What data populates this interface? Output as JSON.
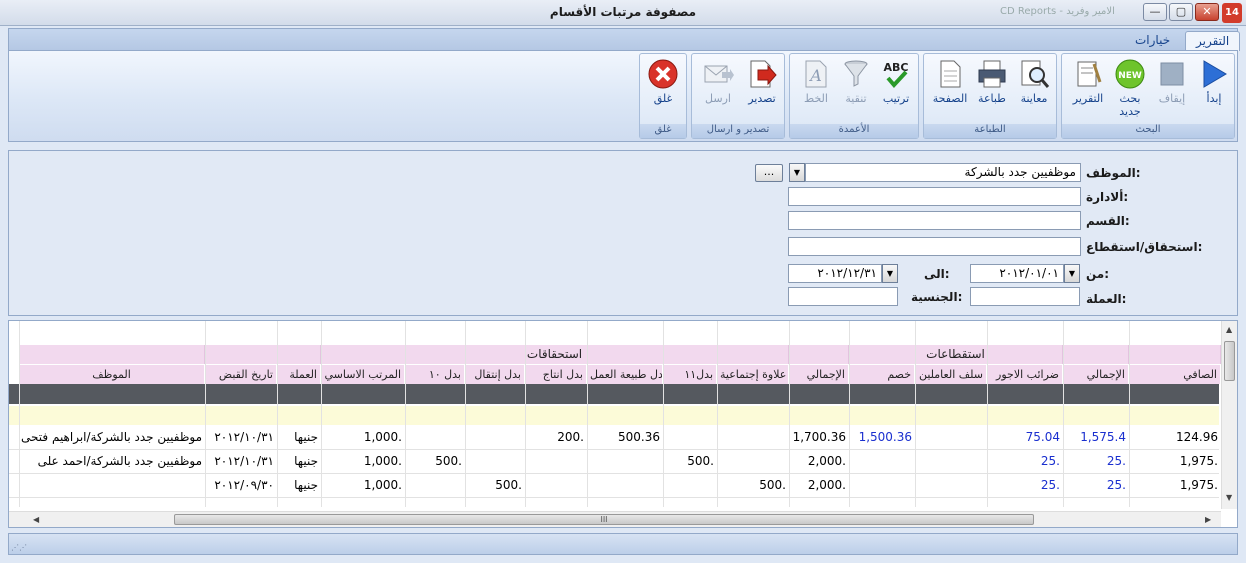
{
  "window": {
    "title": "مصفوفة مرتبات الأقسام",
    "background_title": "CD Reports  -  الامير وفريد",
    "app_icon": "14",
    "minimize": "—",
    "maximize": "▢",
    "close": "✕"
  },
  "ribbon": {
    "tabs": [
      {
        "label": "التقرير",
        "active": true
      },
      {
        "label": "خيارات",
        "active": false
      }
    ],
    "groups": {
      "search": {
        "label": "البحث",
        "buttons": [
          {
            "label": "إبدأ",
            "icon": "play-icon",
            "disabled": false
          },
          {
            "label": "إيقاف",
            "icon": "stop-icon",
            "disabled": true
          },
          {
            "label": "بحث جديد",
            "icon": "new-search-icon",
            "disabled": false
          },
          {
            "label": "التقرير",
            "icon": "report-icon",
            "disabled": false
          }
        ]
      },
      "print": {
        "label": "الطباعة",
        "buttons": [
          {
            "label": "معاينة",
            "icon": "preview-icon",
            "disabled": false
          },
          {
            "label": "طباعة",
            "icon": "printer-icon",
            "disabled": false
          },
          {
            "label": "الصفحة",
            "icon": "page-icon",
            "disabled": false
          }
        ]
      },
      "columns": {
        "label": "الأعمدة",
        "buttons": [
          {
            "label": "ترتيب",
            "icon": "sort-abc-icon",
            "disabled": false
          },
          {
            "label": "تنقية",
            "icon": "filter-icon",
            "disabled": true
          },
          {
            "label": "الخط",
            "icon": "font-icon",
            "disabled": true
          }
        ]
      },
      "export": {
        "label": "تصدير و ارسال",
        "buttons": [
          {
            "label": "تصدير",
            "icon": "export-icon",
            "disabled": false
          },
          {
            "label": "ارسل",
            "icon": "send-mail-icon",
            "disabled": true
          }
        ]
      },
      "close": {
        "label": "غلق",
        "buttons": [
          {
            "label": "غلق",
            "icon": "close-circle-icon",
            "disabled": false
          }
        ]
      }
    }
  },
  "filters": {
    "employee": {
      "label": "الموظف:",
      "value": "موظفيين جدد بالشركة",
      "ellipsis": "..."
    },
    "administration": {
      "label": "ألادارة:",
      "value": ""
    },
    "department": {
      "label": "القسم:",
      "value": ""
    },
    "entitlement": {
      "label": "استحقاق/استقطاع:",
      "value": ""
    },
    "from": {
      "label": "من:",
      "value": "٢٠١٢/٠١/٠١"
    },
    "to": {
      "label": "الى:",
      "value": "٢٠١٢/١٢/٣١"
    },
    "currency": {
      "label": "العملة:",
      "value": ""
    },
    "nationality": {
      "label": "الجنسية:",
      "value": ""
    }
  },
  "grid": {
    "groups": {
      "deductions": "استقطاعات",
      "entitlements": "استحقاقات"
    },
    "columns": {
      "net": "الصافي",
      "total_ded": "الإجمالي",
      "wage_tax": "ضرائب الاجور",
      "worker_advance": "سلف العاملين",
      "discount": "خصم",
      "total_ent": "الإجمالي",
      "social_bonus": "علاوة إجتماعية",
      "allow11": "بدل١١",
      "work_nature": "بدل طبيعة العمل",
      "production": "بدل انتاج",
      "transport": "بدل إنتقال",
      "allow10": "بدل ١٠",
      "basic_salary": "المرتب الاساسي",
      "currency": "العملة",
      "pay_date": "تاريخ القبض",
      "employee": "الموظف"
    },
    "rows": [
      {
        "net": "124.96",
        "total_ded": "1,575.4",
        "wage_tax": "75.04",
        "worker_advance": "",
        "discount": "1,500.36",
        "total_ent": "1,700.36",
        "social_bonus": "",
        "allow11": "",
        "work_nature": "500.36",
        "production": "200.",
        "transport": "",
        "allow10": "",
        "basic_salary": "1,000.",
        "currency": "جنيها",
        "pay_date": "٢٠١٢/١٠/٣١",
        "employee": "موظفيين جدد بالشركة/ابراهيم فتحى"
      },
      {
        "net": "1,975.",
        "total_ded": "25.",
        "wage_tax": "25.",
        "worker_advance": "",
        "discount": "",
        "total_ent": "2,000.",
        "social_bonus": "",
        "allow11": "500.",
        "work_nature": "",
        "production": "",
        "transport": "",
        "allow10": "500.",
        "basic_salary": "1,000.",
        "currency": "جنيها",
        "pay_date": "٢٠١٢/١٠/٣١",
        "employee": "موظفيين جدد بالشركة/احمد على"
      },
      {
        "net": "1,975.",
        "total_ded": "25.",
        "wage_tax": "25.",
        "worker_advance": "",
        "discount": "",
        "total_ent": "2,000.",
        "social_bonus": "500.",
        "allow11": "",
        "work_nature": "",
        "production": "",
        "transport": "500.",
        "allow10": "",
        "basic_salary": "1,000.",
        "currency": "جنيها",
        "pay_date": "٢٠١٢/٠٩/٣٠",
        "employee": ""
      }
    ],
    "hscroll_grip": "III"
  },
  "colors": {
    "ribbon_text": "#15428b",
    "header_pink": "#f2d9ee",
    "dark_row": "#55595f",
    "filter_row": "#fcfbd8",
    "blue_value": "#1a2fcf"
  }
}
